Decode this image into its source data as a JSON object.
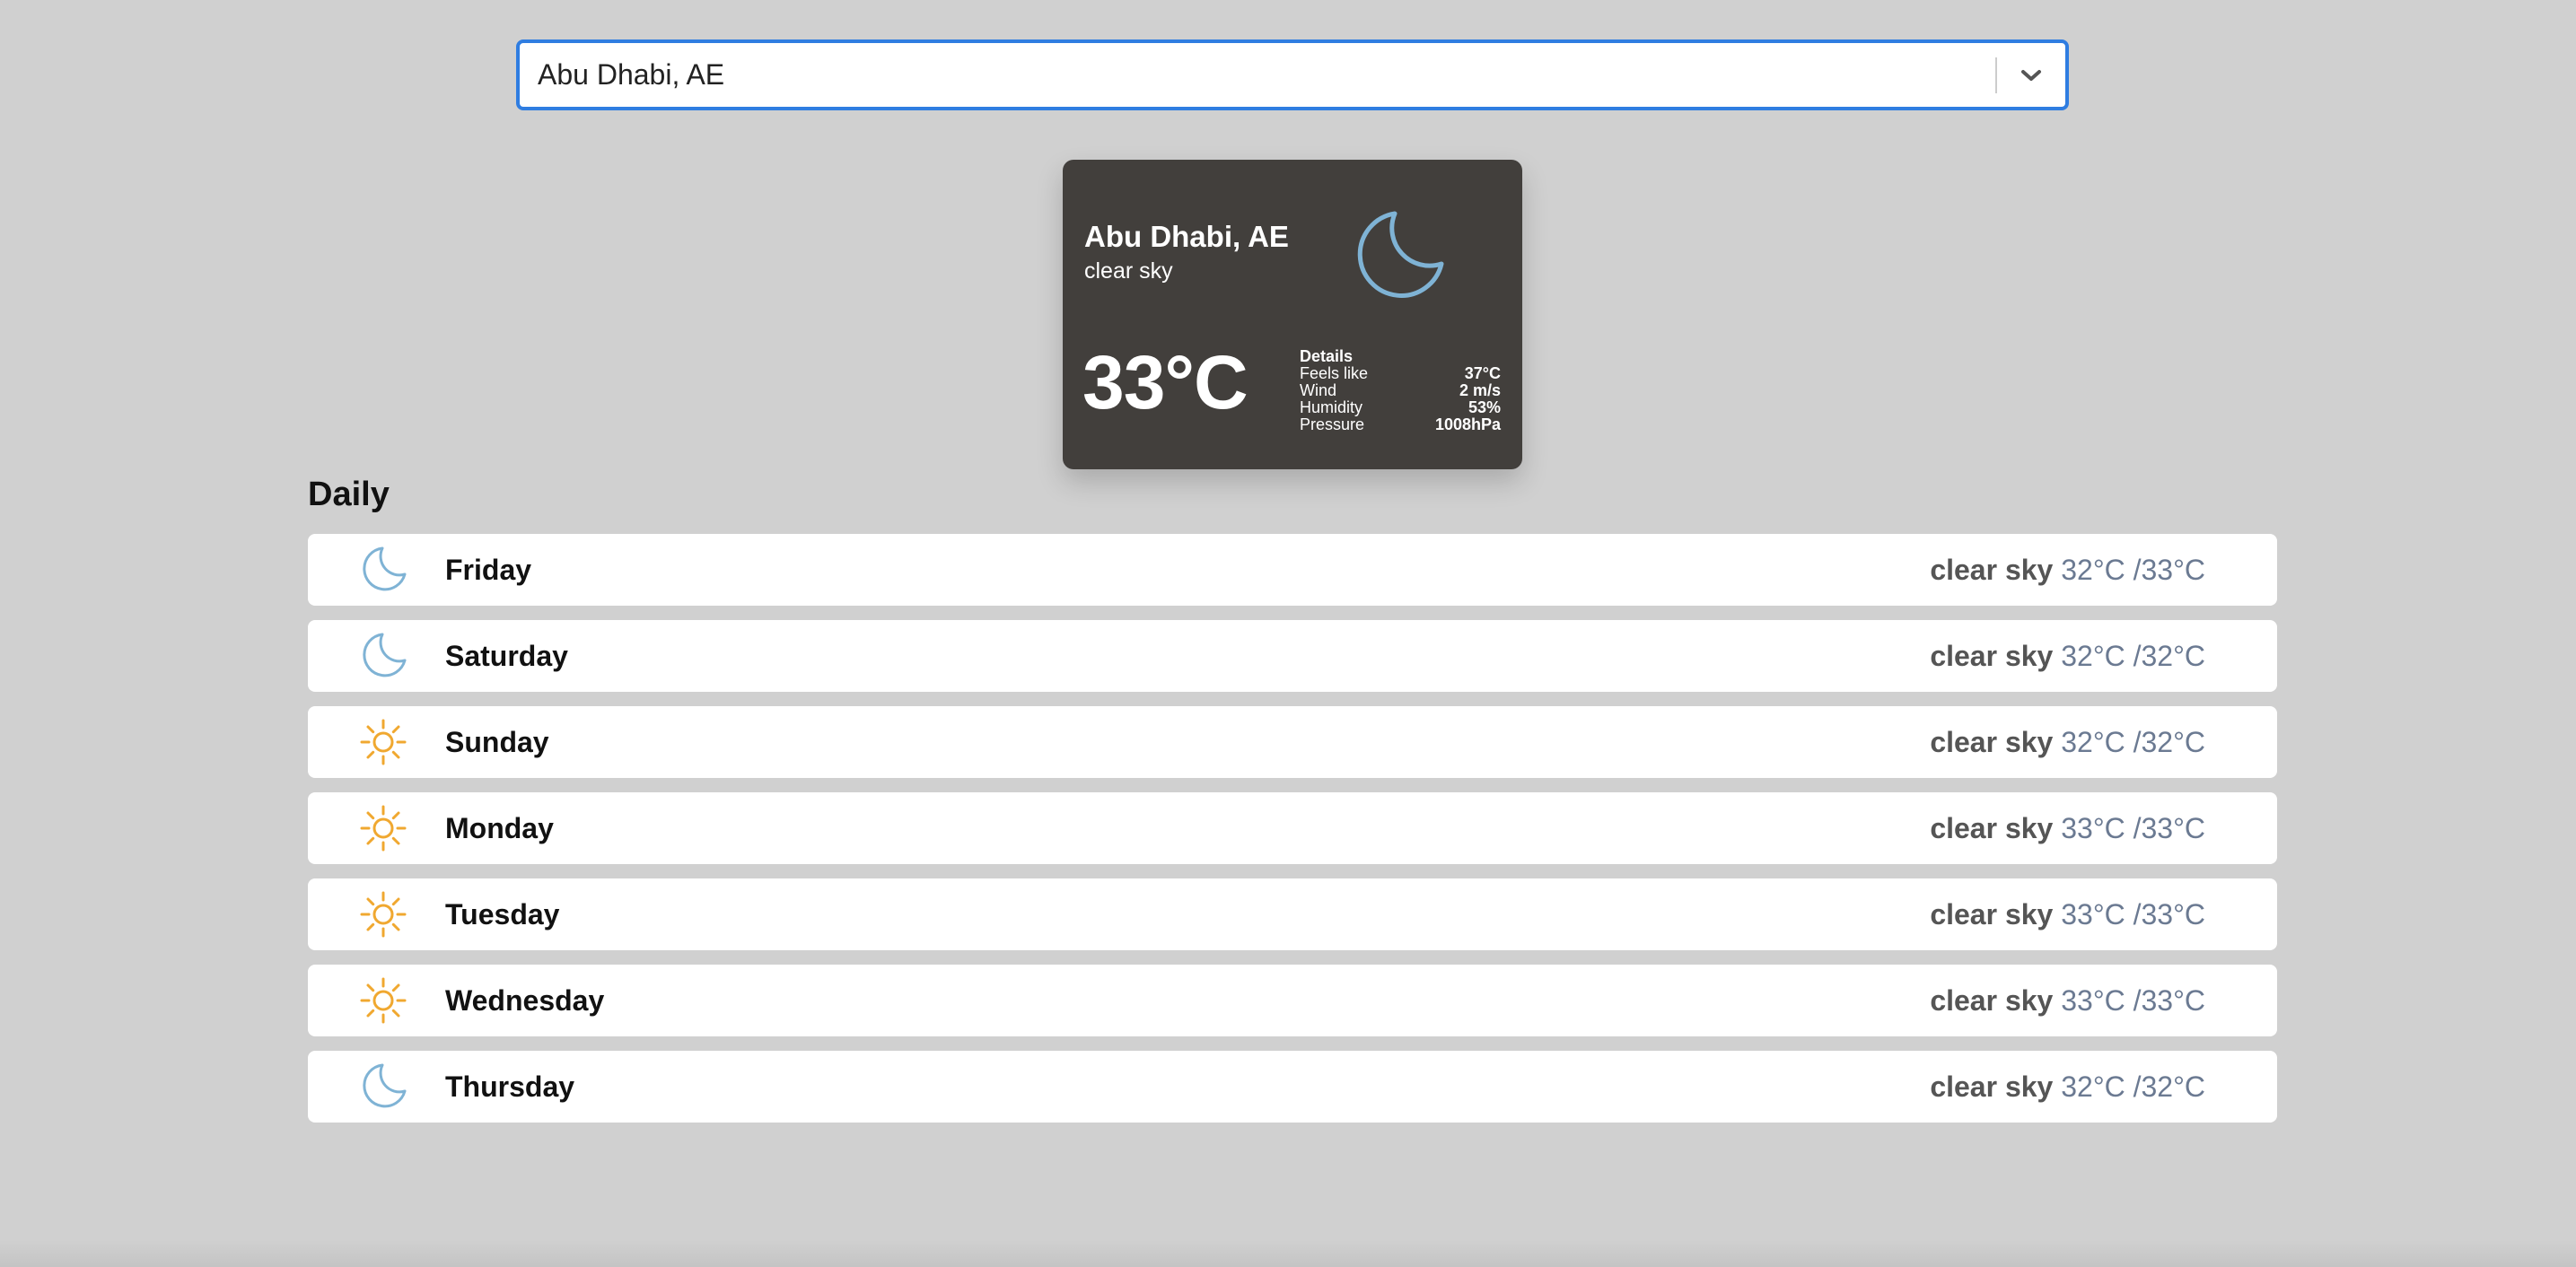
{
  "search": {
    "value": "Abu Dhabi, AE"
  },
  "current": {
    "city": "Abu Dhabi, AE",
    "description": "clear sky",
    "temperature": "33°C",
    "icon": "moon-icon",
    "details_title": "Details",
    "details": [
      {
        "label": "Feels like",
        "value": "37°C"
      },
      {
        "label": "Wind",
        "value": "2 m/s"
      },
      {
        "label": "Humidity",
        "value": "53%"
      },
      {
        "label": "Pressure",
        "value": "1008hPa"
      }
    ]
  },
  "daily": {
    "title": "Daily",
    "days": [
      {
        "name": "Friday",
        "description": "clear sky",
        "temps": "32°C /33°C",
        "icon": "moon-icon"
      },
      {
        "name": "Saturday",
        "description": "clear sky",
        "temps": "32°C /32°C",
        "icon": "moon-icon"
      },
      {
        "name": "Sunday",
        "description": "clear sky",
        "temps": "32°C /32°C",
        "icon": "sun-icon"
      },
      {
        "name": "Monday",
        "description": "clear sky",
        "temps": "33°C /33°C",
        "icon": "sun-icon"
      },
      {
        "name": "Tuesday",
        "description": "clear sky",
        "temps": "33°C /33°C",
        "icon": "sun-icon"
      },
      {
        "name": "Wednesday",
        "description": "clear sky",
        "temps": "33°C /33°C",
        "icon": "sun-icon"
      },
      {
        "name": "Thursday",
        "description": "clear sky",
        "temps": "32°C /32°C",
        "icon": "moon-icon"
      }
    ]
  },
  "colors": {
    "background": "#d0d0d0",
    "card": "#423f3c",
    "accent": "#2f7de1",
    "moon": "#7fb3d5",
    "sun": "#f0a830",
    "temps": "#6b7a92"
  }
}
